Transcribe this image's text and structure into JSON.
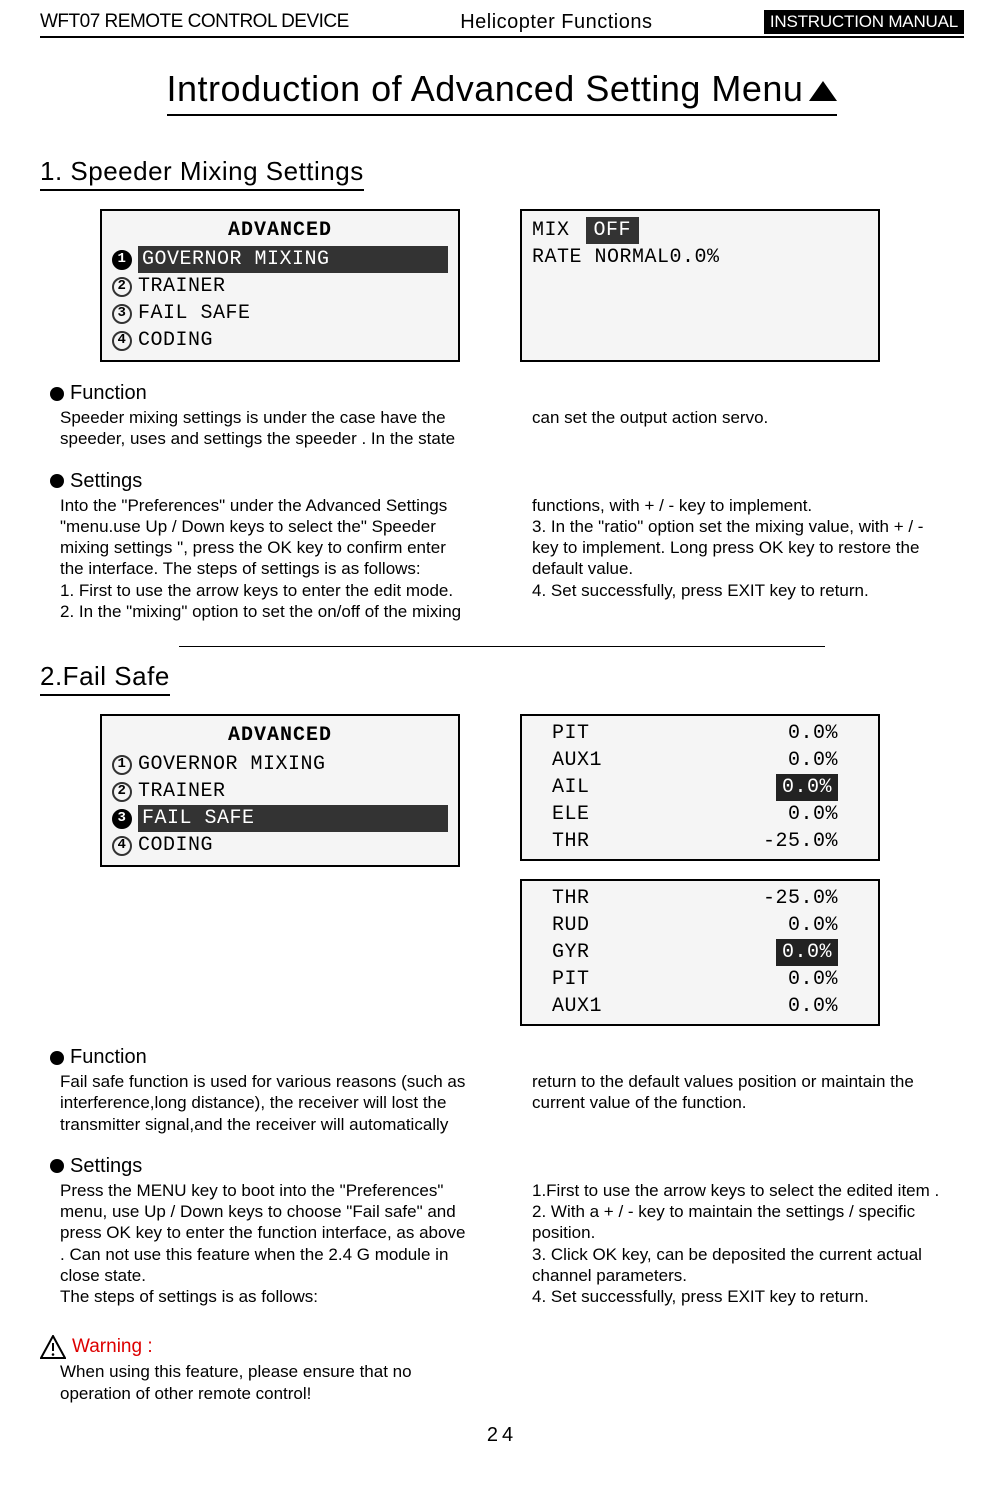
{
  "header": {
    "left": "WFT07 REMOTE CONTROL DEVICE",
    "center": "Helicopter Functions",
    "right": "INSTRUCTION MANUAL"
  },
  "main_title": "Introduction of Advanced Setting Menu",
  "section1": {
    "title": "1. Speeder Mixing Settings",
    "lcd_left": {
      "header": "ADVANCED",
      "items": [
        {
          "n": "1",
          "label": "GOVERNOR MIXING",
          "selected": true
        },
        {
          "n": "2",
          "label": "TRAINER",
          "selected": false
        },
        {
          "n": "3",
          "label": "FAIL SAFE",
          "selected": false
        },
        {
          "n": "4",
          "label": "CODING",
          "selected": false
        }
      ]
    },
    "lcd_right": {
      "line1_label": "MIX",
      "line1_value": "OFF",
      "line2": "RATE NORMAL0.0%"
    },
    "function_head": "Function",
    "function_text": "Speeder mixing settings is under the case have the speeder, uses and settings the speeder . In the state can set the output action servo.",
    "settings_head": "Settings",
    "settings_text": "Into the \"Preferences\" under the Advanced Settings \"menu.use Up / Down keys to select the\" Speeder mixing settings \", press the OK key to confirm enter the interface. The steps of settings is as follows:\n 1. First to use the arrow keys to enter the edit mode.\n2. In the \"mixing\" option to set the on/off of the mixing functions, with + / - key to implement.\n3. In the \"ratio\" option set the mixing value, with + / - key to implement. Long press OK key to restore the default value.\n4. Set successfully, press EXIT key to return."
  },
  "section2": {
    "title": "2.Fail Safe",
    "lcd_left": {
      "header": "ADVANCED",
      "items": [
        {
          "n": "1",
          "label": "GOVERNOR MIXING",
          "selected": false
        },
        {
          "n": "2",
          "label": "TRAINER",
          "selected": false
        },
        {
          "n": "3",
          "label": "FAIL SAFE",
          "selected": true
        },
        {
          "n": "4",
          "label": "CODING",
          "selected": false
        }
      ]
    },
    "lcd_right_top": [
      {
        "ch": "PIT",
        "val": "0.0%",
        "sel": false
      },
      {
        "ch": "AUX1",
        "val": "0.0%",
        "sel": false
      },
      {
        "ch": "AIL",
        "val": "0.0%",
        "sel": true
      },
      {
        "ch": "ELE",
        "val": "0.0%",
        "sel": false
      },
      {
        "ch": "THR",
        "val": "-25.0%",
        "sel": false
      }
    ],
    "lcd_right_bot": [
      {
        "ch": "THR",
        "val": "-25.0%",
        "sel": false
      },
      {
        "ch": "RUD",
        "val": "0.0%",
        "sel": false
      },
      {
        "ch": "GYR",
        "val": "0.0%",
        "sel": true
      },
      {
        "ch": "PIT",
        "val": "0.0%",
        "sel": false
      },
      {
        "ch": "AUX1",
        "val": "0.0%",
        "sel": false
      }
    ],
    "function_head": "Function",
    "function_text": "Fail safe function is used for various reasons (such as interference,long distance), the receiver will lost the transmitter signal,and the receiver will automatically return to the default values position or maintain the current value of the function.",
    "settings_head": "Settings",
    "settings_text": "Press the MENU key to boot into the \"Preferences\" menu, use Up / Down keys to choose \"Fail safe\" and press OK key to enter the function interface, as above . Can not use this feature when the 2.4 G module in close state.\nThe steps of settings is as follows:\n1.First to use the arrow keys to select the edited item .\n2. With a + / - key to maintain the settings / specific position.\n3. Click OK key, can be deposited the current actual channel parameters.\n4. Set successfully, press EXIT key to return."
  },
  "warning": {
    "label": "Warning :",
    "text": "When using this feature, please ensure that no operation of other remote control!"
  },
  "page_number": "24"
}
